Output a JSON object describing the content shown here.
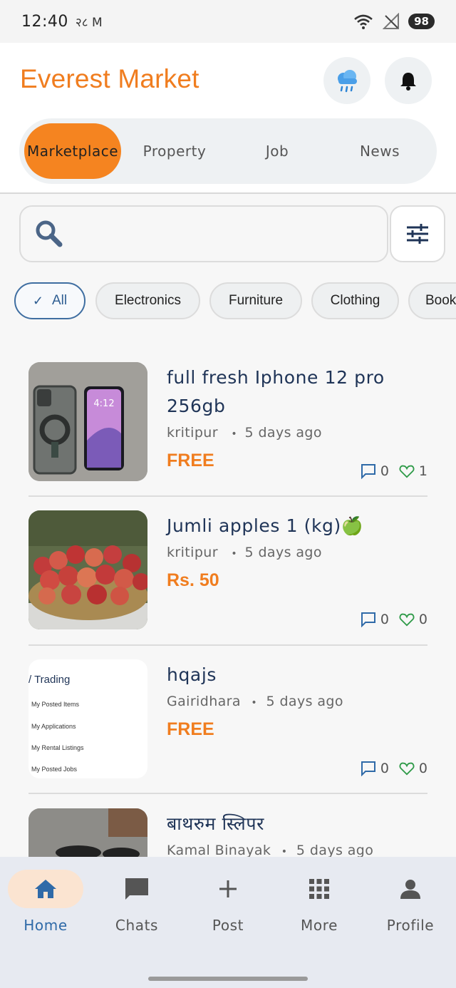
{
  "status": {
    "time": "12:40",
    "mini": "२८ M",
    "signal": "5",
    "battery": "98"
  },
  "header": {
    "app_title": "Everest Market"
  },
  "tabs": [
    {
      "label": "Marketplace",
      "active": true
    },
    {
      "label": "Property",
      "active": false
    },
    {
      "label": "Job",
      "active": false
    },
    {
      "label": "News",
      "active": false
    }
  ],
  "search": {
    "value": "",
    "placeholder": ""
  },
  "chips": [
    {
      "label": "All",
      "check": "✓",
      "active": true
    },
    {
      "label": "Electronics",
      "active": false
    },
    {
      "label": "Furniture",
      "active": false
    },
    {
      "label": "Clothing",
      "active": false
    },
    {
      "label": "Book",
      "active": false
    }
  ],
  "listings": [
    {
      "title": "full fresh Iphone 12 pro 256gb",
      "location": "kritipur",
      "sep": "•",
      "age": "5 days ago",
      "price": "FREE",
      "comments": "0",
      "likes": "1"
    },
    {
      "title": "Jumli apples 1 (kg)🍏",
      "location": "kritipur",
      "sep": "•",
      "age": "5 days ago",
      "price": "Rs. 50",
      "comments": "0",
      "likes": "0"
    },
    {
      "title": "hqajs",
      "location": "Gairidhara",
      "sep": "•",
      "age": "5 days ago",
      "price": "FREE",
      "comments": "0",
      "likes": "0",
      "thumb_text": {
        "heading": "/ Trading",
        "lines": [
          "My Posted Items",
          "My Applications",
          "My Rental Listings",
          "My Posted Jobs"
        ]
      }
    },
    {
      "title": "बाथरुम स्लिपर",
      "location": "Kamal Binayak",
      "sep": "•",
      "age": "5 days ago"
    }
  ],
  "nav": [
    {
      "label": "Home",
      "icon": "home-icon",
      "active": true
    },
    {
      "label": "Chats",
      "icon": "chat-icon",
      "active": false
    },
    {
      "label": "Post",
      "icon": "plus-icon",
      "active": false
    },
    {
      "label": "More",
      "icon": "grid-icon",
      "active": false
    },
    {
      "label": "Profile",
      "icon": "person-icon",
      "active": false
    }
  ],
  "colors": {
    "brand": "#f07d1f",
    "accent": "#2f6aa8",
    "like": "#2e9a48"
  }
}
